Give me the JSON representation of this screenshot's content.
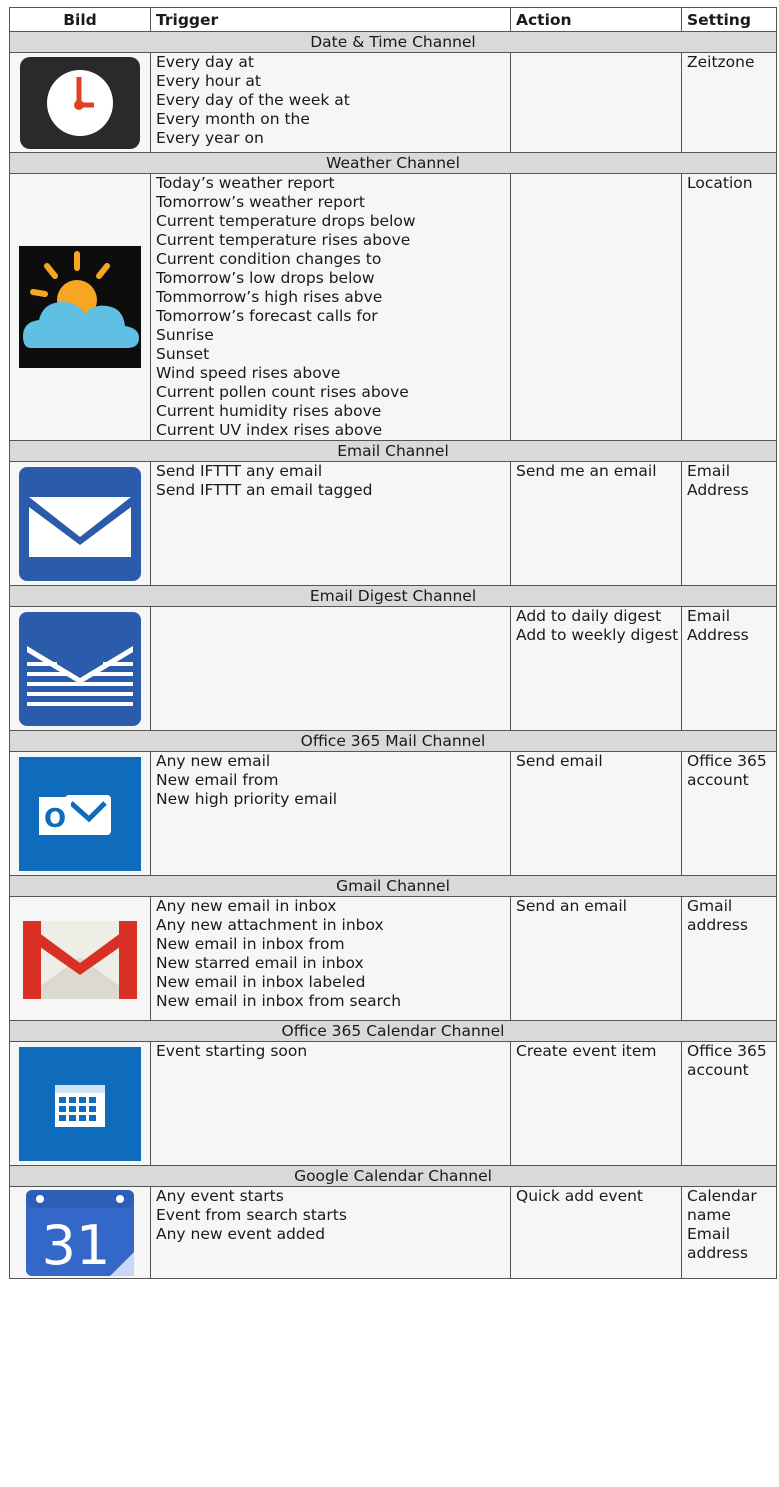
{
  "columns": [
    "Bild",
    "Trigger",
    "Action",
    "Setting"
  ],
  "sections": [
    {
      "title": "Date & Time Channel",
      "icon": "clock-icon",
      "triggers": [
        "Every day at",
        "Every hour at",
        "Every day of the week at",
        "Every month on the",
        "Every year on"
      ],
      "actions": [],
      "setting": "Zeitzone"
    },
    {
      "title": "Weather Channel",
      "icon": "weather-sun-cloud-icon",
      "triggers": [
        "Today’s weather report",
        "Tomorrow’s weather report",
        "Current temperature drops below",
        "Current temperature rises above",
        "Current condition changes to",
        "Tomorrow’s low drops below",
        "Tommorrow’s high rises abve",
        "Tomorrow’s forecast calls for",
        "Sunrise",
        "Sunset",
        "Wind speed rises above",
        "Current pollen count rises above",
        "Current humidity rises above",
        "Current UV index rises above"
      ],
      "actions": [],
      "setting": "Location"
    },
    {
      "title": "Email Channel",
      "icon": "envelope-icon",
      "triggers": [
        "Send IFTTT any email",
        "Send IFTTT an email tagged"
      ],
      "actions": [
        "Send me an email"
      ],
      "setting": "Email Address"
    },
    {
      "title": "Email Digest Channel",
      "icon": "email-digest-icon",
      "triggers": [],
      "actions": [
        "Add to daily digest",
        "Add to weekly digest"
      ],
      "setting": "Email Address"
    },
    {
      "title": "Office 365 Mail Channel",
      "icon": "outlook-icon",
      "triggers": [
        "Any new email",
        "New email from",
        "New high priority email"
      ],
      "actions": [
        "Send email"
      ],
      "setting": "Office 365 account"
    },
    {
      "title": "Gmail Channel",
      "icon": "gmail-icon",
      "triggers": [
        "Any new email in inbox",
        "Any new attachment in inbox",
        "New email in inbox from",
        "New starred email in inbox",
        "New email in inbox labeled",
        "New email in inbox from search"
      ],
      "actions": [
        "Send an email"
      ],
      "setting": "Gmail address"
    },
    {
      "title": "Office 365 Calendar Channel",
      "icon": "office-calendar-icon",
      "triggers": [
        "Event starting soon"
      ],
      "actions": [
        "Create event item"
      ],
      "setting": "Office 365 account"
    },
    {
      "title": "Google Calendar Channel",
      "icon": "google-calendar-icon",
      "triggers": [
        "Any event starts",
        "Event from search starts",
        "Any new event added"
      ],
      "actions": [
        "Quick add event"
      ],
      "setting": "Calendar name Email address"
    }
  ],
  "icon_text": {
    "outlook_letter": "O",
    "calendar_day": "31"
  },
  "colors": {
    "section_bg": "#d9d9d9",
    "cell_bg": "#f6f6f6",
    "mail_blue": "#2a5cab",
    "outlook_blue": "#0f6cbd",
    "clock_red": "#e0421f",
    "sun_orange": "#f5a623",
    "cloud_blue": "#5fc0e3",
    "gmail_red": "#d93025"
  }
}
